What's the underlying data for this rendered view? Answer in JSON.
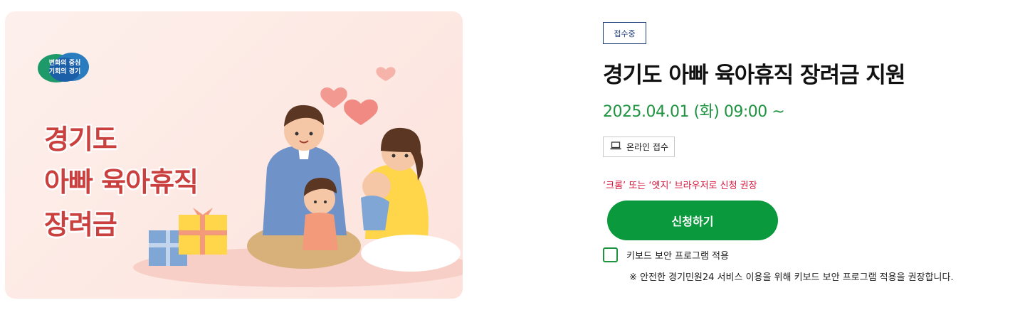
{
  "banner": {
    "logo_line1": "변화의 중심",
    "logo_line2": "기회의 경기",
    "title_line1": "경기도",
    "title_line2": "아빠 육아휴직",
    "title_line3": "장려금"
  },
  "detail": {
    "status_badge": "접수중",
    "title": "경기도 아빠 육아휴직 장려금 지원",
    "date": "2025.04.01 (화) 09:00 ~",
    "online_label": "온라인 접수",
    "browser_notice": "‘크롬’ 또는 ‘엣지‘ 브라우저로 신청 권장",
    "apply_button": "신청하기",
    "keyboard_security_label": "키보드 보안 프로그램 적용",
    "keyboard_security_note": "※ 안전한 경기민원24 서비스 이용을 위해 키보드 보안 프로그램 적용을 권장합니다."
  },
  "colors": {
    "accent_green": "#0a9a3d",
    "title_red": "#c9403e",
    "notice_red": "#d6183f",
    "badge_navy": "#1f3f7a"
  },
  "icons": {
    "online": "laptop-icon",
    "logo": "gyeonggi-logo"
  }
}
